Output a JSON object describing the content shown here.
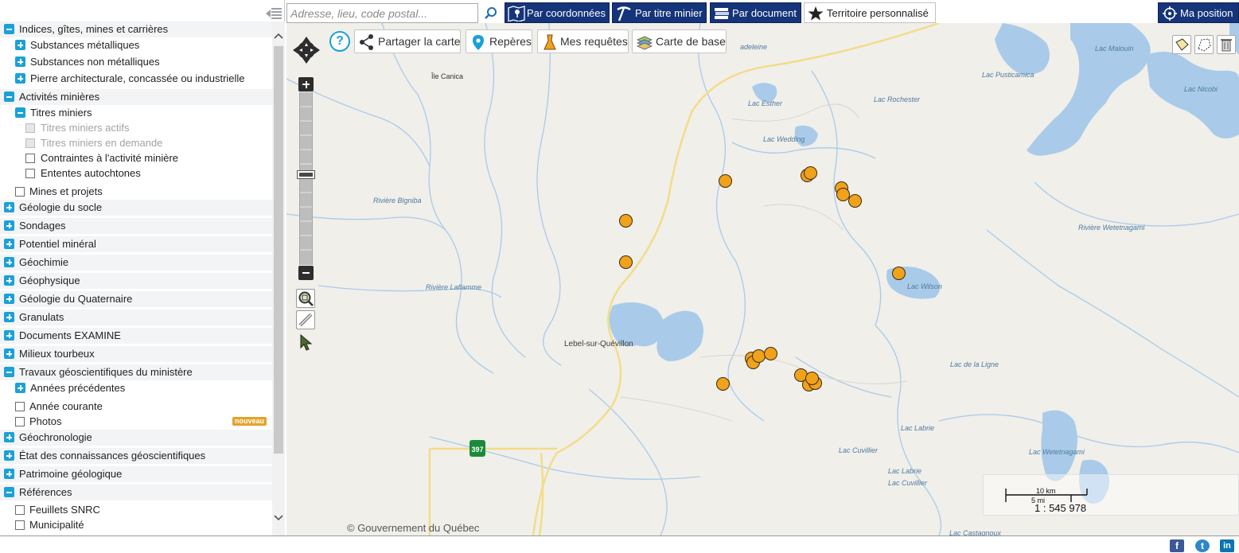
{
  "search": {
    "placeholder": "Adresse, lieu, code postal...",
    "buttons": [
      {
        "label": "Par coordonnées",
        "icon": "map-pin-icon"
      },
      {
        "label": "Par titre minier",
        "icon": "pickaxe-icon"
      },
      {
        "label": "Par document",
        "icon": "books-icon"
      },
      {
        "label": "Territoire personnalisé",
        "icon": "star-icon"
      }
    ],
    "position_label": "Ma position"
  },
  "map_toolbar": {
    "share_label": "Partager la carte",
    "reperes_label": "Repères",
    "requetes_label": "Mes requêtes",
    "basemap_label": "Carte de base"
  },
  "layer_tree": [
    {
      "label": "Indices, gîtes, mines et carrières",
      "level": 1,
      "control": "minus"
    },
    {
      "label": "Substances métalliques",
      "level": 2,
      "control": "plus"
    },
    {
      "label": "Substances non métalliques",
      "level": 2,
      "control": "plus"
    },
    {
      "label": "Pierre architecturale, concassée ou industrielle",
      "level": 2,
      "control": "plus"
    },
    {
      "label": "Activités minières",
      "level": 1,
      "control": "minus"
    },
    {
      "label": "Titres miniers",
      "level": 2,
      "control": "minus"
    },
    {
      "label": "Titres miniers actifs",
      "level": 3,
      "control": "checkbox",
      "disabled": true
    },
    {
      "label": "Titres miniers en demande",
      "level": 3,
      "control": "checkbox",
      "disabled": true
    },
    {
      "label": "Contraintes à l'activité minière",
      "level": 3,
      "control": "checkbox"
    },
    {
      "label": "Ententes autochtones",
      "level": 3,
      "control": "checkbox"
    },
    {
      "label": "Mines et projets",
      "level": 2,
      "control": "checkbox"
    },
    {
      "label": "Géologie du socle",
      "level": 1,
      "control": "plus"
    },
    {
      "label": "Sondages",
      "level": 1,
      "control": "plus"
    },
    {
      "label": "Potentiel minéral",
      "level": 1,
      "control": "plus"
    },
    {
      "label": "Géochimie",
      "level": 1,
      "control": "plus"
    },
    {
      "label": "Géophysique",
      "level": 1,
      "control": "plus"
    },
    {
      "label": "Géologie du Quaternaire",
      "level": 1,
      "control": "plus"
    },
    {
      "label": "Granulats",
      "level": 1,
      "control": "plus"
    },
    {
      "label": "Documents EXAMINE",
      "level": 1,
      "control": "plus"
    },
    {
      "label": "Milieux tourbeux",
      "level": 1,
      "control": "plus"
    },
    {
      "label": "Travaux géoscientifiques du ministère",
      "level": 1,
      "control": "minus"
    },
    {
      "label": "Années précédentes",
      "level": 2,
      "control": "plus"
    },
    {
      "label": "Année courante",
      "level": 2,
      "control": "checkbox"
    },
    {
      "label": "Photos",
      "level": 2,
      "control": "checkbox",
      "badge": "nouveau"
    },
    {
      "label": "Géochronologie",
      "level": 1,
      "control": "plus"
    },
    {
      "label": "État des connaissances géoscientifiques",
      "level": 1,
      "control": "plus"
    },
    {
      "label": "Patrimoine géologique",
      "level": 1,
      "control": "plus"
    },
    {
      "label": "Références",
      "level": 1,
      "control": "minus"
    },
    {
      "label": "Feuillets SNRC",
      "level": 2,
      "control": "checkbox"
    },
    {
      "label": "Municipalité",
      "level": 2,
      "control": "checkbox"
    }
  ],
  "map": {
    "place_labels": [
      {
        "text": "Île Canica",
        "kind": "island"
      },
      {
        "text": "adeleine",
        "kind": "lake"
      },
      {
        "text": "Lac Esther",
        "kind": "lake"
      },
      {
        "text": "Lac Rochester",
        "kind": "lake"
      },
      {
        "text": "Lac Pusticamica",
        "kind": "lake"
      },
      {
        "text": "Lac Malouin",
        "kind": "lake"
      },
      {
        "text": "Lac Nicobi",
        "kind": "lake"
      },
      {
        "text": "Lac Wedding",
        "kind": "lake"
      },
      {
        "text": "Rivière Bigniba",
        "kind": "river"
      },
      {
        "text": "Rivière Wetetnagami",
        "kind": "river"
      },
      {
        "text": "Rivière Laflamme",
        "kind": "river"
      },
      {
        "text": "Lac Wilson",
        "kind": "lake"
      },
      {
        "text": "Lebel-sur-Quévillon",
        "kind": "town"
      },
      {
        "text": "Lac de la Ligne",
        "kind": "lake"
      },
      {
        "text": "Lac Labrie",
        "kind": "lake"
      },
      {
        "text": "Lac Cuvillier",
        "kind": "lake"
      },
      {
        "text": "Lac Labrie",
        "kind": "lake"
      },
      {
        "text": "Lac Cuvillier",
        "kind": "lake"
      },
      {
        "text": "Lac Wetetnagami",
        "kind": "lake"
      },
      {
        "text": "Lac Castagnoux",
        "kind": "lake"
      }
    ],
    "route_shield": "397",
    "scale": {
      "km": "10 km",
      "mi": "5 mi",
      "ratio": "1 : 545 978"
    },
    "copyright": "© Gouvernement du Québec",
    "marker_color": "#f0a21b"
  },
  "footer": {
    "social": [
      {
        "label": "f",
        "icon": "facebook-icon",
        "color": "#3b5998"
      },
      {
        "label": "t",
        "icon": "twitter-icon",
        "color": "#2f86c9"
      },
      {
        "label": "in",
        "icon": "linkedin-icon",
        "color": "#0b74b3"
      }
    ]
  },
  "colors": {
    "toolbar": "#15347a",
    "toggle": "#1aa1d6",
    "water": "#a9cbe9",
    "land": "#f0efea",
    "road": "#f3dc86"
  }
}
